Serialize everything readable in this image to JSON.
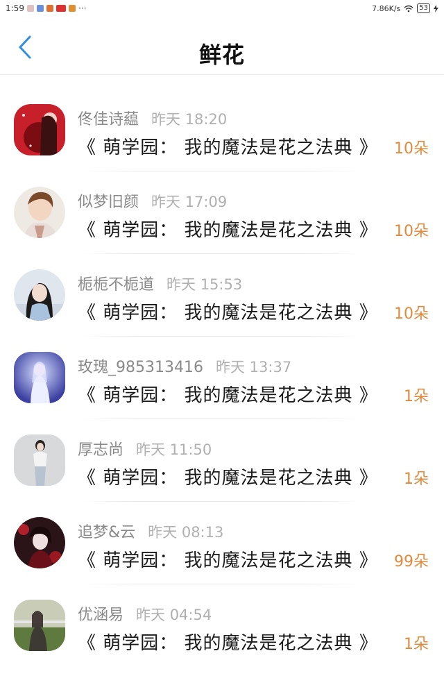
{
  "status_bar": {
    "time": "1:59",
    "more": "···",
    "network_speed": "7.86K/s",
    "battery": "53"
  },
  "header": {
    "title": "鲜花",
    "back_icon": "chevron-left-icon",
    "accent_color": "#2f8ee0"
  },
  "gifts": [
    {
      "name": "佟佳诗藴",
      "time": "昨天 18:20",
      "book": "《 萌学园： 我的魔法是花之法典 》",
      "count": "10朵"
    },
    {
      "name": "似梦旧颜",
      "time": "昨天 17:09",
      "book": "《 萌学园： 我的魔法是花之法典 》",
      "count": "10朵"
    },
    {
      "name": "栀栀不栀道",
      "time": "昨天 15:53",
      "book": "《 萌学园： 我的魔法是花之法典 》",
      "count": "10朵"
    },
    {
      "name": "玫瑰_985313416",
      "time": "昨天 13:37",
      "book": "《 萌学园： 我的魔法是花之法典 》",
      "count": "1朵"
    },
    {
      "name": "厚志尚",
      "time": "昨天 11:50",
      "book": "《 萌学园： 我的魔法是花之法典 》",
      "count": "1朵"
    },
    {
      "name": "追梦&云",
      "time": "昨天 08:13",
      "book": "《 萌学园： 我的魔法是花之法典 》",
      "count": "99朵"
    },
    {
      "name": "优涵易",
      "time": "昨天 04:54",
      "book": "《 萌学园： 我的魔法是花之法典 》",
      "count": "1朵"
    }
  ],
  "count_color": "#e08a3c"
}
